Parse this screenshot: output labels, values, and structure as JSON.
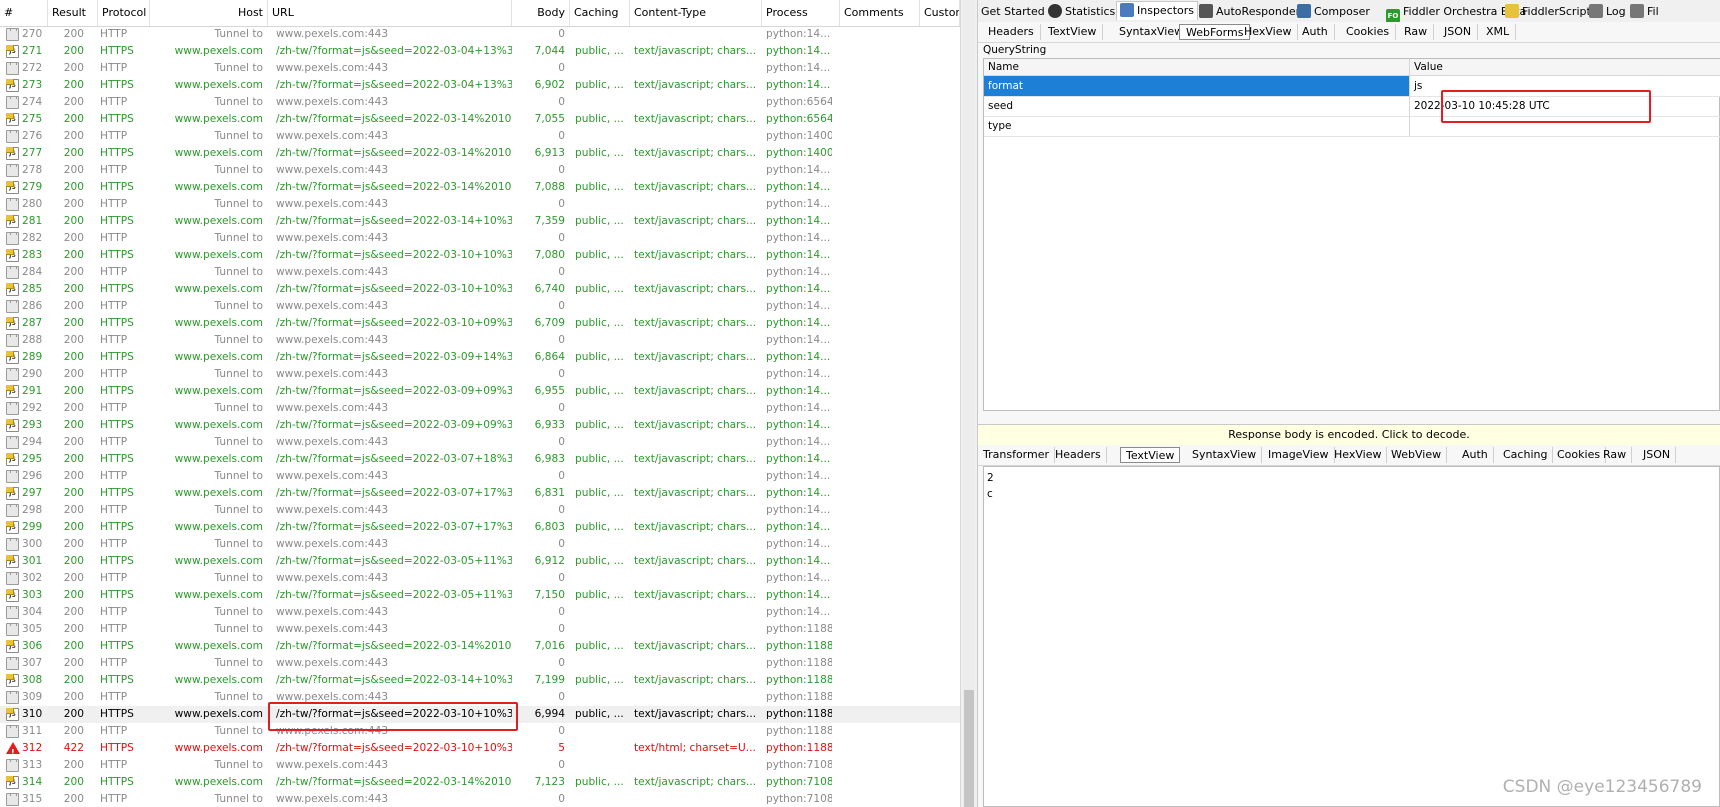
{
  "columns": [
    "#",
    "Result",
    "Protocol",
    "Host",
    "URL",
    "Body",
    "Caching",
    "Content-Type",
    "Process",
    "Comments",
    "Custom"
  ],
  "rows": [
    {
      "icon": "lock",
      "num": "270",
      "result": "200",
      "protocol": "HTTP",
      "host": "Tunnel to",
      "url": "www.pexels.com:443",
      "body": "0",
      "caching": "",
      "ctype": "",
      "process": "python:14...",
      "kind": "tunnel"
    },
    {
      "icon": "js",
      "num": "271",
      "result": "200",
      "protocol": "HTTPS",
      "host": "www.pexels.com",
      "url": "/zh-tw/?format=js&seed=2022-03-04+13%3...",
      "body": "7,044",
      "caching": "public, ...",
      "ctype": "text/javascript; chars...",
      "process": "python:14...",
      "kind": "ok"
    },
    {
      "icon": "lock",
      "num": "272",
      "result": "200",
      "protocol": "HTTP",
      "host": "Tunnel to",
      "url": "www.pexels.com:443",
      "body": "0",
      "caching": "",
      "ctype": "",
      "process": "python:14...",
      "kind": "tunnel"
    },
    {
      "icon": "js",
      "num": "273",
      "result": "200",
      "protocol": "HTTPS",
      "host": "www.pexels.com",
      "url": "/zh-tw/?format=js&seed=2022-03-04+13%3...",
      "body": "6,902",
      "caching": "public, ...",
      "ctype": "text/javascript; chars...",
      "process": "python:14...",
      "kind": "ok"
    },
    {
      "icon": "lock",
      "num": "274",
      "result": "200",
      "protocol": "HTTP",
      "host": "Tunnel to",
      "url": "www.pexels.com:443",
      "body": "0",
      "caching": "",
      "ctype": "",
      "process": "python:6564",
      "kind": "tunnel"
    },
    {
      "icon": "js",
      "num": "275",
      "result": "200",
      "protocol": "HTTPS",
      "host": "www.pexels.com",
      "url": "/zh-tw/?format=js&seed=2022-03-14%2010...",
      "body": "7,055",
      "caching": "public, ...",
      "ctype": "text/javascript; chars...",
      "process": "python:6564",
      "kind": "ok"
    },
    {
      "icon": "lock",
      "num": "276",
      "result": "200",
      "protocol": "HTTP",
      "host": "Tunnel to",
      "url": "www.pexels.com:443",
      "body": "0",
      "caching": "",
      "ctype": "",
      "process": "python:1400",
      "kind": "tunnel"
    },
    {
      "icon": "js",
      "num": "277",
      "result": "200",
      "protocol": "HTTPS",
      "host": "www.pexels.com",
      "url": "/zh-tw/?format=js&seed=2022-03-14%2010...",
      "body": "6,913",
      "caching": "public, ...",
      "ctype": "text/javascript; chars...",
      "process": "python:1400",
      "kind": "ok"
    },
    {
      "icon": "lock",
      "num": "278",
      "result": "200",
      "protocol": "HTTP",
      "host": "Tunnel to",
      "url": "www.pexels.com:443",
      "body": "0",
      "caching": "",
      "ctype": "",
      "process": "python:14...",
      "kind": "tunnel"
    },
    {
      "icon": "js",
      "num": "279",
      "result": "200",
      "protocol": "HTTPS",
      "host": "www.pexels.com",
      "url": "/zh-tw/?format=js&seed=2022-03-14%2010...",
      "body": "7,088",
      "caching": "public, ...",
      "ctype": "text/javascript; chars...",
      "process": "python:14...",
      "kind": "ok"
    },
    {
      "icon": "lock",
      "num": "280",
      "result": "200",
      "protocol": "HTTP",
      "host": "Tunnel to",
      "url": "www.pexels.com:443",
      "body": "0",
      "caching": "",
      "ctype": "",
      "process": "python:14...",
      "kind": "tunnel"
    },
    {
      "icon": "js",
      "num": "281",
      "result": "200",
      "protocol": "HTTPS",
      "host": "www.pexels.com",
      "url": "/zh-tw/?format=js&seed=2022-03-14+10%3...",
      "body": "7,359",
      "caching": "public, ...",
      "ctype": "text/javascript; chars...",
      "process": "python:14...",
      "kind": "ok"
    },
    {
      "icon": "lock",
      "num": "282",
      "result": "200",
      "protocol": "HTTP",
      "host": "Tunnel to",
      "url": "www.pexels.com:443",
      "body": "0",
      "caching": "",
      "ctype": "",
      "process": "python:14...",
      "kind": "tunnel"
    },
    {
      "icon": "js",
      "num": "283",
      "result": "200",
      "protocol": "HTTPS",
      "host": "www.pexels.com",
      "url": "/zh-tw/?format=js&seed=2022-03-10+10%3...",
      "body": "7,080",
      "caching": "public, ...",
      "ctype": "text/javascript; chars...",
      "process": "python:14...",
      "kind": "ok"
    },
    {
      "icon": "lock",
      "num": "284",
      "result": "200",
      "protocol": "HTTP",
      "host": "Tunnel to",
      "url": "www.pexels.com:443",
      "body": "0",
      "caching": "",
      "ctype": "",
      "process": "python:14...",
      "kind": "tunnel"
    },
    {
      "icon": "js",
      "num": "285",
      "result": "200",
      "protocol": "HTTPS",
      "host": "www.pexels.com",
      "url": "/zh-tw/?format=js&seed=2022-03-10+10%3...",
      "body": "6,740",
      "caching": "public, ...",
      "ctype": "text/javascript; chars...",
      "process": "python:14...",
      "kind": "ok"
    },
    {
      "icon": "lock",
      "num": "286",
      "result": "200",
      "protocol": "HTTP",
      "host": "Tunnel to",
      "url": "www.pexels.com:443",
      "body": "0",
      "caching": "",
      "ctype": "",
      "process": "python:14...",
      "kind": "tunnel"
    },
    {
      "icon": "js",
      "num": "287",
      "result": "200",
      "protocol": "HTTPS",
      "host": "www.pexels.com",
      "url": "/zh-tw/?format=js&seed=2022-03-10+09%3...",
      "body": "6,709",
      "caching": "public, ...",
      "ctype": "text/javascript; chars...",
      "process": "python:14...",
      "kind": "ok"
    },
    {
      "icon": "lock",
      "num": "288",
      "result": "200",
      "protocol": "HTTP",
      "host": "Tunnel to",
      "url": "www.pexels.com:443",
      "body": "0",
      "caching": "",
      "ctype": "",
      "process": "python:14...",
      "kind": "tunnel"
    },
    {
      "icon": "js",
      "num": "289",
      "result": "200",
      "protocol": "HTTPS",
      "host": "www.pexels.com",
      "url": "/zh-tw/?format=js&seed=2022-03-09+14%3...",
      "body": "6,864",
      "caching": "public, ...",
      "ctype": "text/javascript; chars...",
      "process": "python:14...",
      "kind": "ok"
    },
    {
      "icon": "lock",
      "num": "290",
      "result": "200",
      "protocol": "HTTP",
      "host": "Tunnel to",
      "url": "www.pexels.com:443",
      "body": "0",
      "caching": "",
      "ctype": "",
      "process": "python:14...",
      "kind": "tunnel"
    },
    {
      "icon": "js",
      "num": "291",
      "result": "200",
      "protocol": "HTTPS",
      "host": "www.pexels.com",
      "url": "/zh-tw/?format=js&seed=2022-03-09+09%3...",
      "body": "6,955",
      "caching": "public, ...",
      "ctype": "text/javascript; chars...",
      "process": "python:14...",
      "kind": "ok"
    },
    {
      "icon": "lock",
      "num": "292",
      "result": "200",
      "protocol": "HTTP",
      "host": "Tunnel to",
      "url": "www.pexels.com:443",
      "body": "0",
      "caching": "",
      "ctype": "",
      "process": "python:14...",
      "kind": "tunnel"
    },
    {
      "icon": "js",
      "num": "293",
      "result": "200",
      "protocol": "HTTPS",
      "host": "www.pexels.com",
      "url": "/zh-tw/?format=js&seed=2022-03-09+09%3...",
      "body": "6,933",
      "caching": "public, ...",
      "ctype": "text/javascript; chars...",
      "process": "python:14...",
      "kind": "ok"
    },
    {
      "icon": "lock",
      "num": "294",
      "result": "200",
      "protocol": "HTTP",
      "host": "Tunnel to",
      "url": "www.pexels.com:443",
      "body": "0",
      "caching": "",
      "ctype": "",
      "process": "python:14...",
      "kind": "tunnel"
    },
    {
      "icon": "js",
      "num": "295",
      "result": "200",
      "protocol": "HTTPS",
      "host": "www.pexels.com",
      "url": "/zh-tw/?format=js&seed=2022-03-07+18%3...",
      "body": "6,983",
      "caching": "public, ...",
      "ctype": "text/javascript; chars...",
      "process": "python:14...",
      "kind": "ok"
    },
    {
      "icon": "lock",
      "num": "296",
      "result": "200",
      "protocol": "HTTP",
      "host": "Tunnel to",
      "url": "www.pexels.com:443",
      "body": "0",
      "caching": "",
      "ctype": "",
      "process": "python:14...",
      "kind": "tunnel"
    },
    {
      "icon": "js",
      "num": "297",
      "result": "200",
      "protocol": "HTTPS",
      "host": "www.pexels.com",
      "url": "/zh-tw/?format=js&seed=2022-03-07+17%3...",
      "body": "6,831",
      "caching": "public, ...",
      "ctype": "text/javascript; chars...",
      "process": "python:14...",
      "kind": "ok"
    },
    {
      "icon": "lock",
      "num": "298",
      "result": "200",
      "protocol": "HTTP",
      "host": "Tunnel to",
      "url": "www.pexels.com:443",
      "body": "0",
      "caching": "",
      "ctype": "",
      "process": "python:14...",
      "kind": "tunnel"
    },
    {
      "icon": "js",
      "num": "299",
      "result": "200",
      "protocol": "HTTPS",
      "host": "www.pexels.com",
      "url": "/zh-tw/?format=js&seed=2022-03-07+17%3...",
      "body": "6,803",
      "caching": "public, ...",
      "ctype": "text/javascript; chars...",
      "process": "python:14...",
      "kind": "ok"
    },
    {
      "icon": "lock",
      "num": "300",
      "result": "200",
      "protocol": "HTTP",
      "host": "Tunnel to",
      "url": "www.pexels.com:443",
      "body": "0",
      "caching": "",
      "ctype": "",
      "process": "python:14...",
      "kind": "tunnel"
    },
    {
      "icon": "js",
      "num": "301",
      "result": "200",
      "protocol": "HTTPS",
      "host": "www.pexels.com",
      "url": "/zh-tw/?format=js&seed=2022-03-05+11%3...",
      "body": "6,912",
      "caching": "public, ...",
      "ctype": "text/javascript; chars...",
      "process": "python:14...",
      "kind": "ok"
    },
    {
      "icon": "lock",
      "num": "302",
      "result": "200",
      "protocol": "HTTP",
      "host": "Tunnel to",
      "url": "www.pexels.com:443",
      "body": "0",
      "caching": "",
      "ctype": "",
      "process": "python:14...",
      "kind": "tunnel"
    },
    {
      "icon": "js",
      "num": "303",
      "result": "200",
      "protocol": "HTTPS",
      "host": "www.pexels.com",
      "url": "/zh-tw/?format=js&seed=2022-03-05+11%3...",
      "body": "7,150",
      "caching": "public, ...",
      "ctype": "text/javascript; chars...",
      "process": "python:14...",
      "kind": "ok"
    },
    {
      "icon": "lock",
      "num": "304",
      "result": "200",
      "protocol": "HTTP",
      "host": "Tunnel to",
      "url": "www.pexels.com:443",
      "body": "0",
      "caching": "",
      "ctype": "",
      "process": "python:14...",
      "kind": "tunnel"
    },
    {
      "icon": "lock",
      "num": "305",
      "result": "200",
      "protocol": "HTTP",
      "host": "Tunnel to",
      "url": "www.pexels.com:443",
      "body": "0",
      "caching": "",
      "ctype": "",
      "process": "python:1188",
      "kind": "tunnel"
    },
    {
      "icon": "js",
      "num": "306",
      "result": "200",
      "protocol": "HTTPS",
      "host": "www.pexels.com",
      "url": "/zh-tw/?format=js&seed=2022-03-14%2010...",
      "body": "7,016",
      "caching": "public, ...",
      "ctype": "text/javascript; chars...",
      "process": "python:1188",
      "kind": "ok"
    },
    {
      "icon": "lock",
      "num": "307",
      "result": "200",
      "protocol": "HTTP",
      "host": "Tunnel to",
      "url": "www.pexels.com:443",
      "body": "0",
      "caching": "",
      "ctype": "",
      "process": "python:1188",
      "kind": "tunnel"
    },
    {
      "icon": "js",
      "num": "308",
      "result": "200",
      "protocol": "HTTPS",
      "host": "www.pexels.com",
      "url": "/zh-tw/?format=js&seed=2022-03-14+10%3...",
      "body": "7,199",
      "caching": "public, ...",
      "ctype": "text/javascript; chars...",
      "process": "python:1188",
      "kind": "ok"
    },
    {
      "icon": "lock",
      "num": "309",
      "result": "200",
      "protocol": "HTTP",
      "host": "Tunnel to",
      "url": "www.pexels.com:443",
      "body": "0",
      "caching": "",
      "ctype": "",
      "process": "python:1188",
      "kind": "tunnel"
    },
    {
      "icon": "js",
      "num": "310",
      "result": "200",
      "protocol": "HTTPS",
      "host": "www.pexels.com",
      "url": "/zh-tw/?format=js&seed=2022-03-10+10%3...",
      "body": "6,994",
      "caching": "public, ...",
      "ctype": "text/javascript; chars...",
      "process": "python:1188",
      "kind": "sel"
    },
    {
      "icon": "lock",
      "num": "311",
      "result": "200",
      "protocol": "HTTP",
      "host": "Tunnel to",
      "url": "www.pexels.com:443",
      "body": "0",
      "caching": "",
      "ctype": "",
      "process": "python:1188",
      "kind": "tunnel"
    },
    {
      "icon": "warn",
      "num": "312",
      "result": "422",
      "protocol": "HTTPS",
      "host": "www.pexels.com",
      "url": "/zh-tw/?format=js&seed=2022-03-10+10%3...",
      "body": "5",
      "caching": "",
      "ctype": "text/html; charset=U...",
      "process": "python:1188",
      "kind": "err"
    },
    {
      "icon": "lock",
      "num": "313",
      "result": "200",
      "protocol": "HTTP",
      "host": "Tunnel to",
      "url": "www.pexels.com:443",
      "body": "0",
      "caching": "",
      "ctype": "",
      "process": "python:7108",
      "kind": "tunnel"
    },
    {
      "icon": "js",
      "num": "314",
      "result": "200",
      "protocol": "HTTPS",
      "host": "www.pexels.com",
      "url": "/zh-tw/?format=js&seed=2022-03-14%2010...",
      "body": "7,123",
      "caching": "public, ...",
      "ctype": "text/javascript; chars...",
      "process": "python:7108",
      "kind": "ok"
    },
    {
      "icon": "lock",
      "num": "315",
      "result": "200",
      "protocol": "HTTP",
      "host": "Tunnel to",
      "url": "www.pexels.com:443",
      "body": "0",
      "caching": "",
      "ctype": "",
      "process": "python:7108",
      "kind": "tunnel"
    }
  ],
  "top_tabs": [
    {
      "label": "Get Started",
      "icon": ""
    },
    {
      "label": "Statistics",
      "icon": "stopwatch-icon"
    },
    {
      "label": "Inspectors",
      "icon": "inspector-icon"
    },
    {
      "label": "AutoResponder",
      "icon": "lightning-icon"
    },
    {
      "label": "Composer",
      "icon": "composer-icon"
    },
    {
      "label": "Fiddler Orchestra Beta",
      "icon": "fo-icon"
    },
    {
      "label": "FiddlerScript",
      "icon": "script-icon"
    },
    {
      "label": "Log",
      "icon": "log-icon"
    },
    {
      "label": "Fil",
      "icon": "filter-icon"
    }
  ],
  "request_tabs": [
    "Headers",
    "TextView",
    "SyntaxView",
    "WebForms",
    "HexView",
    "Auth",
    "Cookies",
    "Raw",
    "JSON",
    "XML"
  ],
  "request_active_tab": "WebForms",
  "querystring": {
    "label": "QueryString",
    "col_name": "Name",
    "col_value": "Value",
    "rows": [
      {
        "name": "format",
        "value": "js"
      },
      {
        "name": "seed",
        "value": "2022-03-10 10:45:28 UTC"
      },
      {
        "name": "type",
        "value": ""
      }
    ]
  },
  "response_notice": "Response body is encoded. Click to decode.",
  "response_tabs": [
    "Transformer",
    "Headers",
    "TextView",
    "SyntaxView",
    "ImageView",
    "HexView",
    "WebView",
    "Auth",
    "Caching",
    "Cookies",
    "Raw",
    "JSON"
  ],
  "response_active_tab": "TextView",
  "response_text": [
    "2",
    "c"
  ],
  "watermark": "CSDN @eye123456789",
  "colors": {
    "ok": "#2c9a2c",
    "tunnel": "#8a8a8a",
    "error": "#e01010",
    "highlight": "#e02020",
    "selected": "#1e7fd6"
  }
}
